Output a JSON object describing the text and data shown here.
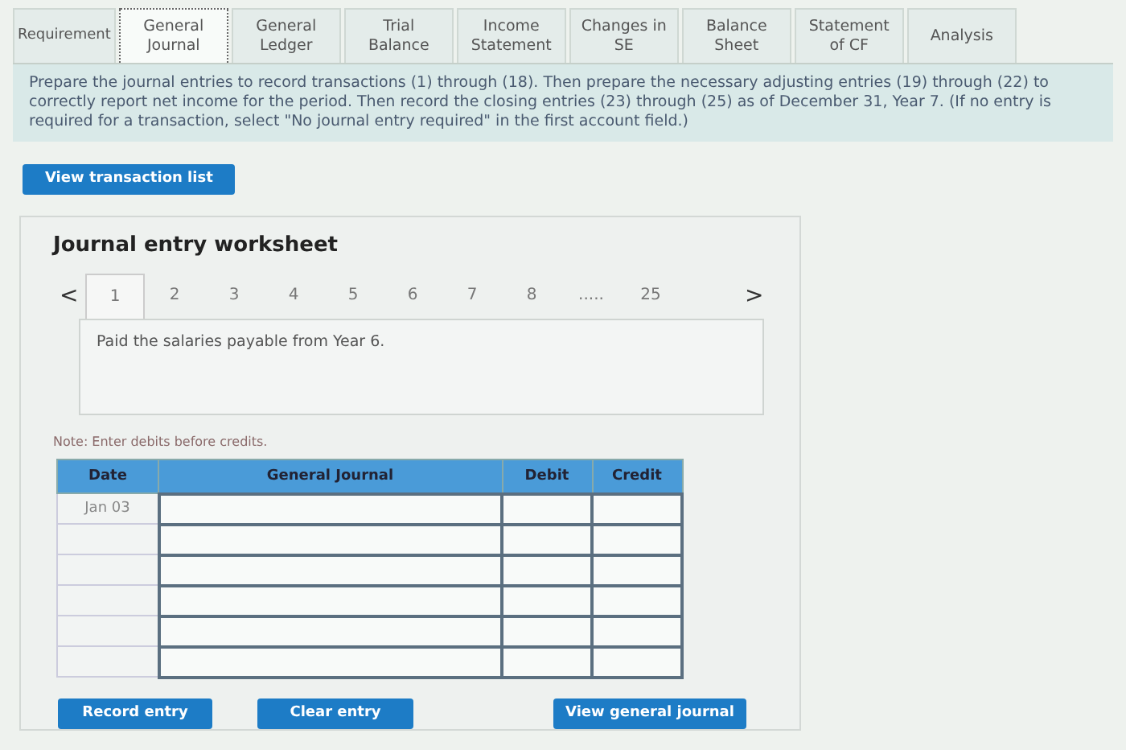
{
  "tabs": [
    {
      "label": "Requirement",
      "selected": false
    },
    {
      "label": "General Journal",
      "selected": true
    },
    {
      "label": "General Ledger",
      "selected": false
    },
    {
      "label": "Trial Balance",
      "selected": false
    },
    {
      "label": "Income Statement",
      "selected": false
    },
    {
      "label": "Changes in SE",
      "selected": false
    },
    {
      "label": "Balance Sheet",
      "selected": false
    },
    {
      "label": "Statement of CF",
      "selected": false
    },
    {
      "label": "Analysis",
      "selected": false
    }
  ],
  "instructions": "Prepare the journal entries to record transactions (1) through (18). Then prepare the necessary adjusting entries (19) through (22) to correctly report net income for the period. Then record the closing entries (23) through (25) as of December 31, Year 7. (If no entry is required for a transaction, select \"No journal entry required\" in the first account field.)",
  "view_transaction_list_button": "View transaction list",
  "worksheet": {
    "title": "Journal entry worksheet",
    "prev": "<",
    "next": ">",
    "pages": [
      {
        "label": "1",
        "selected": true
      },
      {
        "label": "2",
        "selected": false
      },
      {
        "label": "3",
        "selected": false
      },
      {
        "label": "4",
        "selected": false
      },
      {
        "label": "5",
        "selected": false
      },
      {
        "label": "6",
        "selected": false
      },
      {
        "label": "7",
        "selected": false
      },
      {
        "label": "8",
        "selected": false
      },
      {
        "label": ".....",
        "selected": false
      },
      {
        "label": "25",
        "selected": false
      }
    ],
    "transaction": "Paid the salaries payable from Year 6.",
    "note": "Note: Enter debits before credits.",
    "table": {
      "columns": [
        "Date",
        "General Journal",
        "Debit",
        "Credit"
      ],
      "rows": [
        {
          "date": "Jan 03"
        },
        {},
        {},
        {},
        {},
        {}
      ]
    },
    "buttons": [
      "Record entry",
      "Clear entry",
      "View general journal"
    ]
  }
}
